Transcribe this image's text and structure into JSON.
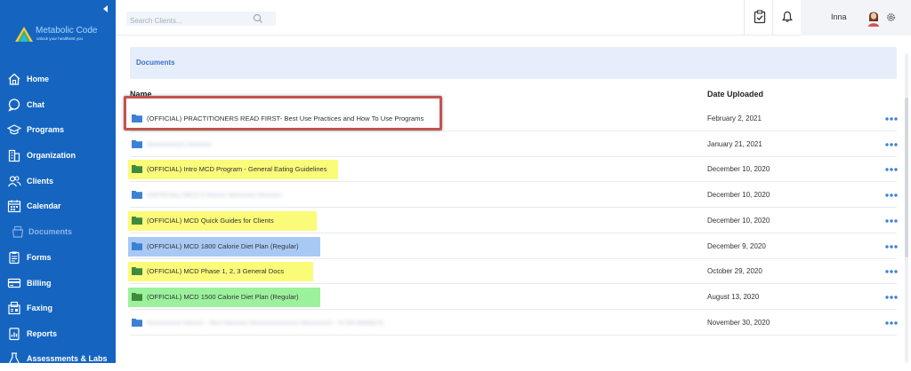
{
  "sidebar": {
    "logo_name": "Metabolic Code",
    "logo_tagline": "unlock your healthiest you",
    "items": [
      {
        "label": "Home",
        "icon": "home-icon"
      },
      {
        "label": "Chat",
        "icon": "chat-icon"
      },
      {
        "label": "Programs",
        "icon": "graduation-cap-icon"
      },
      {
        "label": "Organization",
        "icon": "building-icon"
      },
      {
        "label": "Clients",
        "icon": "people-icon"
      },
      {
        "label": "Calendar",
        "icon": "calendar-icon"
      },
      {
        "label": "Documents",
        "icon": "document-icon",
        "active": true
      },
      {
        "label": "Forms",
        "icon": "clipboard-icon"
      },
      {
        "label": "Billing",
        "icon": "credit-card-icon"
      },
      {
        "label": "Faxing",
        "icon": "fax-icon"
      },
      {
        "label": "Reports",
        "icon": "report-icon"
      },
      {
        "label": "Assessments & Labs",
        "icon": "flask-icon"
      }
    ]
  },
  "topbar": {
    "search_placeholder": "Search Clients...",
    "user_name": "Inna"
  },
  "documents": {
    "header": "Documents",
    "col_name": "Name",
    "col_date": "Date Uploaded",
    "rows": [
      {
        "name": "(OFFICIAL) PRACTITIONERS READ FIRST- Best Use Practices and How To Use Programs",
        "date": "February 2, 2021",
        "folder_color": "#3b82d6",
        "highlight": ""
      },
      {
        "name": "Nnnnnnnnnn Nnnnnn",
        "date": "January 21, 2021",
        "folder_color": "#3b82d6",
        "highlight": "",
        "blurred": true
      },
      {
        "name": "(OFFICIAL) Intro MCD Program - General Eating Guidelines",
        "date": "December 10, 2020",
        "folder_color": "#3f8a3f",
        "highlight": "#fbfb7a"
      },
      {
        "name": "(OFFICIAL) MCD 5 Nnnnn Nnnnnnn Nnnnnn",
        "date": "December 10, 2020",
        "folder_color": "#3b82d6",
        "highlight": "",
        "blurred": true
      },
      {
        "name": "(OFFICIAL) MCD Quick Guides for Clients",
        "date": "December 10, 2020",
        "folder_color": "#3f8a3f",
        "highlight": "#fbfb7a"
      },
      {
        "name": "(OFFICIAL) MCD 1800 Calorie Diet Plan (Regular)",
        "date": "December 9, 2020",
        "folder_color": "#3b82d6",
        "highlight": "#a9c9f5"
      },
      {
        "name": "(OFFICIAL) MCD Phase 1, 2, 3 General Docs",
        "date": "October 29, 2020",
        "folder_color": "#3f8a3f",
        "highlight": "#fbfb7a"
      },
      {
        "name": "(OFFICIAL) MCD 1500 Calorie Diet Plan (Regular)",
        "date": "August 13, 2020",
        "folder_color": "#3f8a3f",
        "highlight": "#9cf29c"
      },
      {
        "name": "Nnnnnnnnn Nnnnn - Nnn Nnnnnn Nnnnnnnnnnnnn Nnnnnnnn - N NN NNNN N",
        "date": "November 30, 2020",
        "folder_color": "#3b82d6",
        "highlight": "",
        "blurred": true
      }
    ]
  },
  "colors": {
    "sidebar": "#1565c0",
    "accent_blue": "#3d71c4",
    "callout_border": "#c0554f",
    "more_dots": "#3b82d6"
  }
}
